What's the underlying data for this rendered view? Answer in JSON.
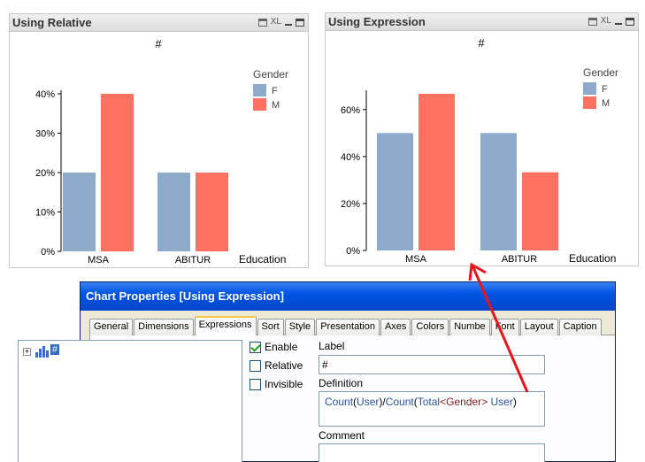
{
  "colors": {
    "female": "#8eaacb",
    "male": "#ff7262",
    "axis": "#000000"
  },
  "charts": [
    {
      "title": "Using Relative",
      "chart_data": {
        "type": "bar",
        "title": "#",
        "categories": [
          "MSA",
          "ABITUR"
        ],
        "xlabel": "Education",
        "ylabel": "",
        "legend_title": "Gender",
        "legend_position": "top-right",
        "series": [
          {
            "name": "F",
            "values": [
              20,
              20
            ]
          },
          {
            "name": "M",
            "values": [
              40,
              20
            ]
          }
        ],
        "yticks": [
          0,
          10,
          20,
          30,
          40
        ],
        "ytick_labels": [
          "0%",
          "10%",
          "20%",
          "30%",
          "40%"
        ],
        "ylim": [
          0,
          40
        ],
        "grid": false
      }
    },
    {
      "title": "Using Expression",
      "chart_data": {
        "type": "bar",
        "title": "#",
        "categories": [
          "MSA",
          "ABITUR"
        ],
        "xlabel": "Education",
        "ylabel": "",
        "legend_title": "Gender",
        "legend_position": "top-right",
        "series": [
          {
            "name": "F",
            "values": [
              50,
              50
            ]
          },
          {
            "name": "M",
            "values": [
              66.7,
              33.3
            ]
          }
        ],
        "yticks": [
          0,
          20,
          40,
          60
        ],
        "ytick_labels": [
          "0%",
          "20%",
          "40%",
          "60%"
        ],
        "ylim": [
          0,
          66.7
        ],
        "grid": false
      }
    }
  ],
  "caption_icons": [
    "print-icon",
    "xl-icon",
    "minimize-icon",
    "maximize-icon"
  ],
  "xl_label": "XL",
  "dialog": {
    "title": "Chart Properties [Using Expression]",
    "tabs": [
      "General",
      "Dimensions",
      "Expressions",
      "Sort",
      "Style",
      "Presentation",
      "Axes",
      "Colors",
      "Numbe",
      "Font",
      "Layout",
      "Caption"
    ],
    "active_tab": "Expressions",
    "tree": {
      "expander": "+",
      "item_label": "#"
    },
    "checkboxes": [
      {
        "label": "Enable",
        "checked": true
      },
      {
        "label": "Relative",
        "checked": false
      },
      {
        "label": "Invisible",
        "checked": false
      }
    ],
    "label_caption": "Label",
    "label_value": "#",
    "definition_caption": "Definition",
    "definition": {
      "fn1": "Count",
      "p1": "(",
      "arg1": "User",
      "p2": ")/",
      "fn2": "Count",
      "p3": "(",
      "kw": "Total",
      "set_open": "<",
      "field": "Gender",
      "set_close": ">",
      "arg2": " User",
      "p4": ")"
    },
    "comment_caption": "Comment"
  }
}
